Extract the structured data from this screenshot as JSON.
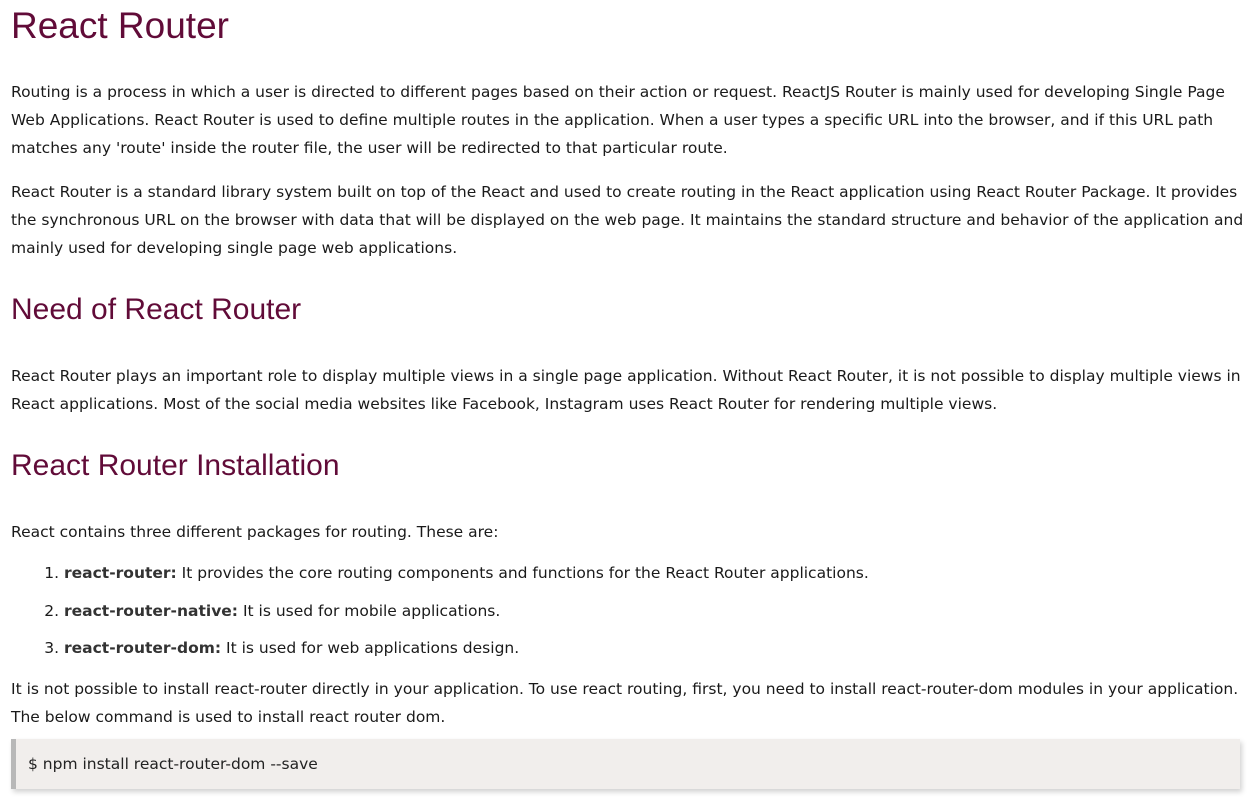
{
  "title": "React Router",
  "intro": [
    "Routing is a process in which a user is directed to different pages based on their action or request. ReactJS Router is mainly used for developing Single Page Web Applications. React Router is used to define multiple routes in the application. When a user types a specific URL into the browser, and if this URL path matches any 'route' inside the router file, the user will be redirected to that particular route.",
    "React Router is a standard library system built on top of the React and used to create routing in the React application using React Router Package. It provides the synchronous URL on the browser with data that will be displayed on the web page. It maintains the standard structure and behavior of the application and mainly used for developing single page web applications."
  ],
  "need": {
    "heading": "Need of React Router",
    "text": "React Router plays an important role to display multiple views in a single page application. Without React Router, it is not possible to display multiple views in React applications. Most of the social media websites like Facebook, Instagram uses React Router for rendering multiple views."
  },
  "installation": {
    "heading": "React Router Installation",
    "lead": "React contains three different packages for routing. These are:",
    "packages": [
      {
        "name": "react-router:",
        "desc": " It provides the core routing components and functions for the React Router applications."
      },
      {
        "name": "react-router-native:",
        "desc": " It is used for mobile applications."
      },
      {
        "name": "react-router-dom:",
        "desc": " It is used for web applications design."
      }
    ],
    "note": "It is not possible to install react-router directly in your application. To use react routing, first, you need to install react-router-dom modules in your application. The below command is used to install react router dom.",
    "command": "$ npm install react-router-dom --save"
  }
}
